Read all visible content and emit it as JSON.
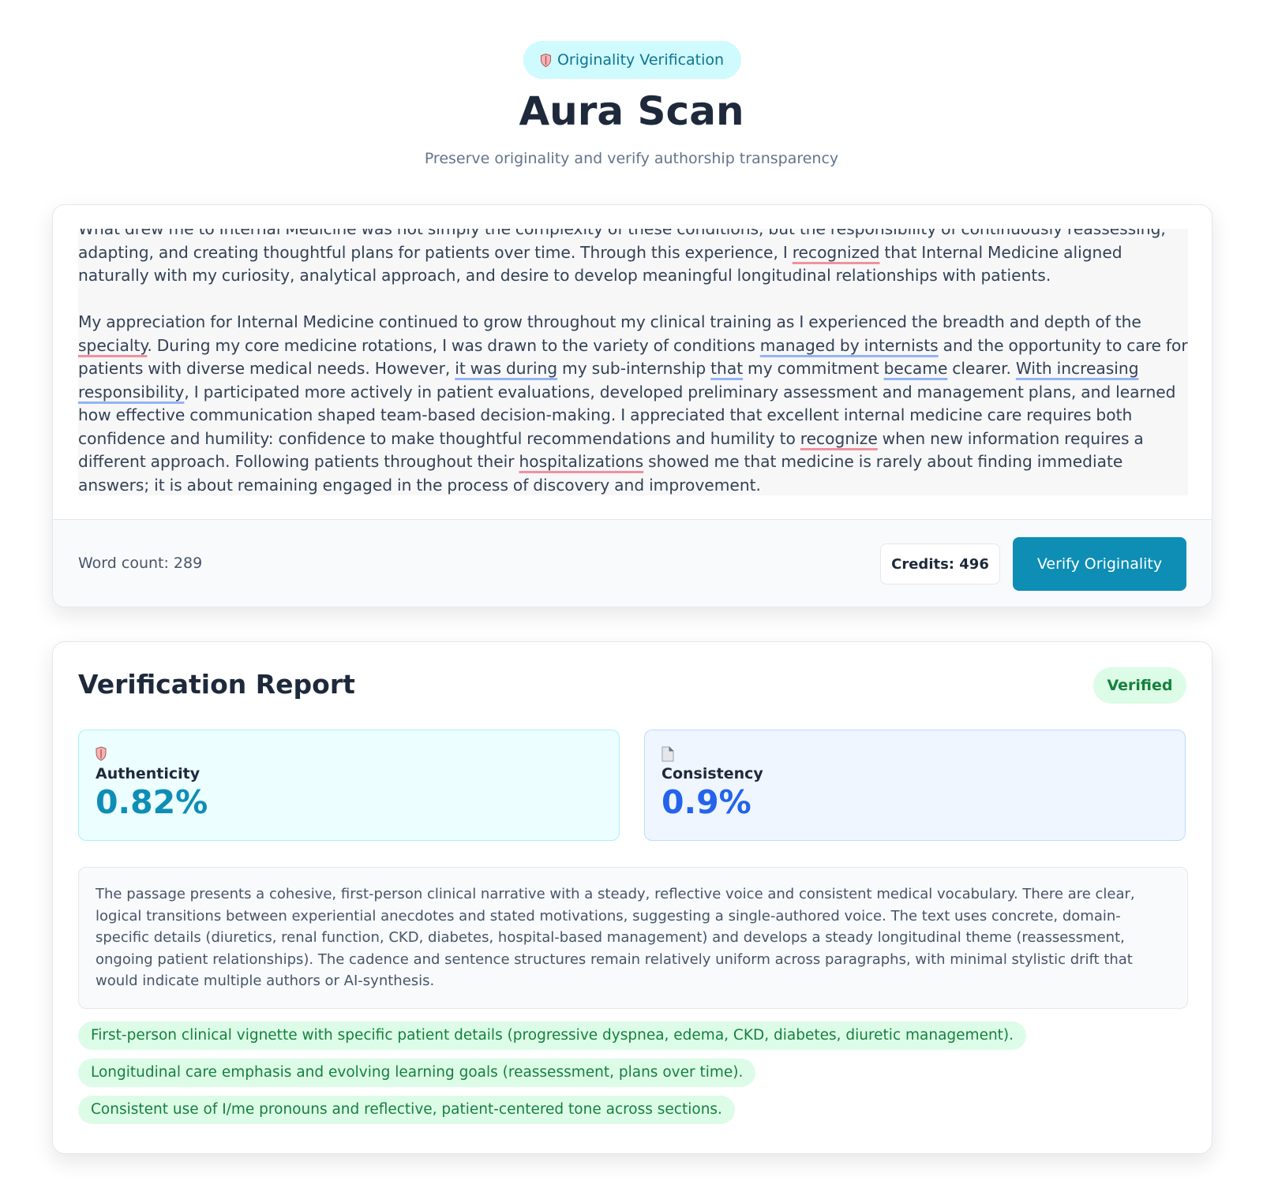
{
  "header": {
    "badge_label": "Originality Verification",
    "title": "Aura Scan",
    "subtitle": "Preserve originality and verify authorship transparency"
  },
  "editor": {
    "paragraph1": [
      {
        "t": "What drew me to Internal Medicine was not simply the complexity of these conditions, but the responsibility of continuously reassessing, adapting, and creating thoughtful plans for patients over time. Through this experience, I "
      },
      {
        "t": "recognized",
        "u": "red"
      },
      {
        "t": " that Internal Medicine aligned naturally with my curiosity, analytical approach, and desire to develop meaningful longitudinal relationships with patients."
      }
    ],
    "paragraph2": [
      {
        "t": "My appreciation for Internal Medicine continued to grow throughout my clinical training as I experienced the breadth and depth of the "
      },
      {
        "t": "specialty",
        "u": "red"
      },
      {
        "t": ". During my core medicine rotations, I was drawn to the variety of conditions "
      },
      {
        "t": "managed by internists",
        "u": "blue"
      },
      {
        "t": " and the opportunity to care for patients with diverse medical needs. However, "
      },
      {
        "t": "it was during",
        "u": "blue"
      },
      {
        "t": " my sub-internship "
      },
      {
        "t": "that",
        "u": "blue"
      },
      {
        "t": " my commitment "
      },
      {
        "t": "became",
        "u": "blue"
      },
      {
        "t": " clearer. "
      },
      {
        "t": "With increasing responsibility",
        "u": "blue"
      },
      {
        "t": ", I participated more actively in patient evaluations, developed preliminary assessment and management plans, and learned how effective communication shaped team-based decision-making. I appreciated that excellent internal medicine care requires both confidence and humility: confidence to make thoughtful recommendations and humility to "
      },
      {
        "t": "recognize",
        "u": "red"
      },
      {
        "t": " when new information requires a different approach. Following patients throughout their "
      },
      {
        "t": "hospitalizations",
        "u": "red"
      },
      {
        "t": " showed me that medicine is rarely about finding immediate answers; it is about remaining engaged in the process of discovery and improvement."
      }
    ],
    "word_count": "Word count: 289",
    "credits": "Credits: 496",
    "verify_label": "Verify Originality"
  },
  "report": {
    "title": "Verification Report",
    "status": "Verified",
    "authenticity": {
      "icon": "shield-icon",
      "label": "Authenticity",
      "value": "0.82%"
    },
    "consistency": {
      "icon": "document-icon",
      "label": "Consistency",
      "value": "0.9%"
    },
    "analysis": "The passage presents a cohesive, first-person clinical narrative with a steady, reflective voice and consistent medical vocabulary. There are clear, logical transitions between experiential anecdotes and stated motivations, suggesting a single-authored voice. The text uses concrete, domain-specific details (diuretics, renal function, CKD, diabetes, hospital-based management) and develops a steady longitudinal theme (reassessment, ongoing patient relationships). The cadence and sentence structures remain relatively uniform across paragraphs, with minimal stylistic drift that would indicate multiple authors or AI-synthesis.",
    "signals": [
      "First-person clinical vignette with specific patient details (progressive dyspnea, edema, CKD, diabetes, diuretic management).",
      "Longitudinal care emphasis and evolving learning goals (reassessment, plans over time).",
      "Consistent use of I/me pronouns and reflective, patient-centered tone across sections."
    ]
  },
  "colors": {
    "accent": "#0e8eb5",
    "consistency_blue": "#2563eb",
    "verified_green": "#15803d",
    "underline_red": "#f0919f",
    "underline_blue": "#93b4f5"
  }
}
